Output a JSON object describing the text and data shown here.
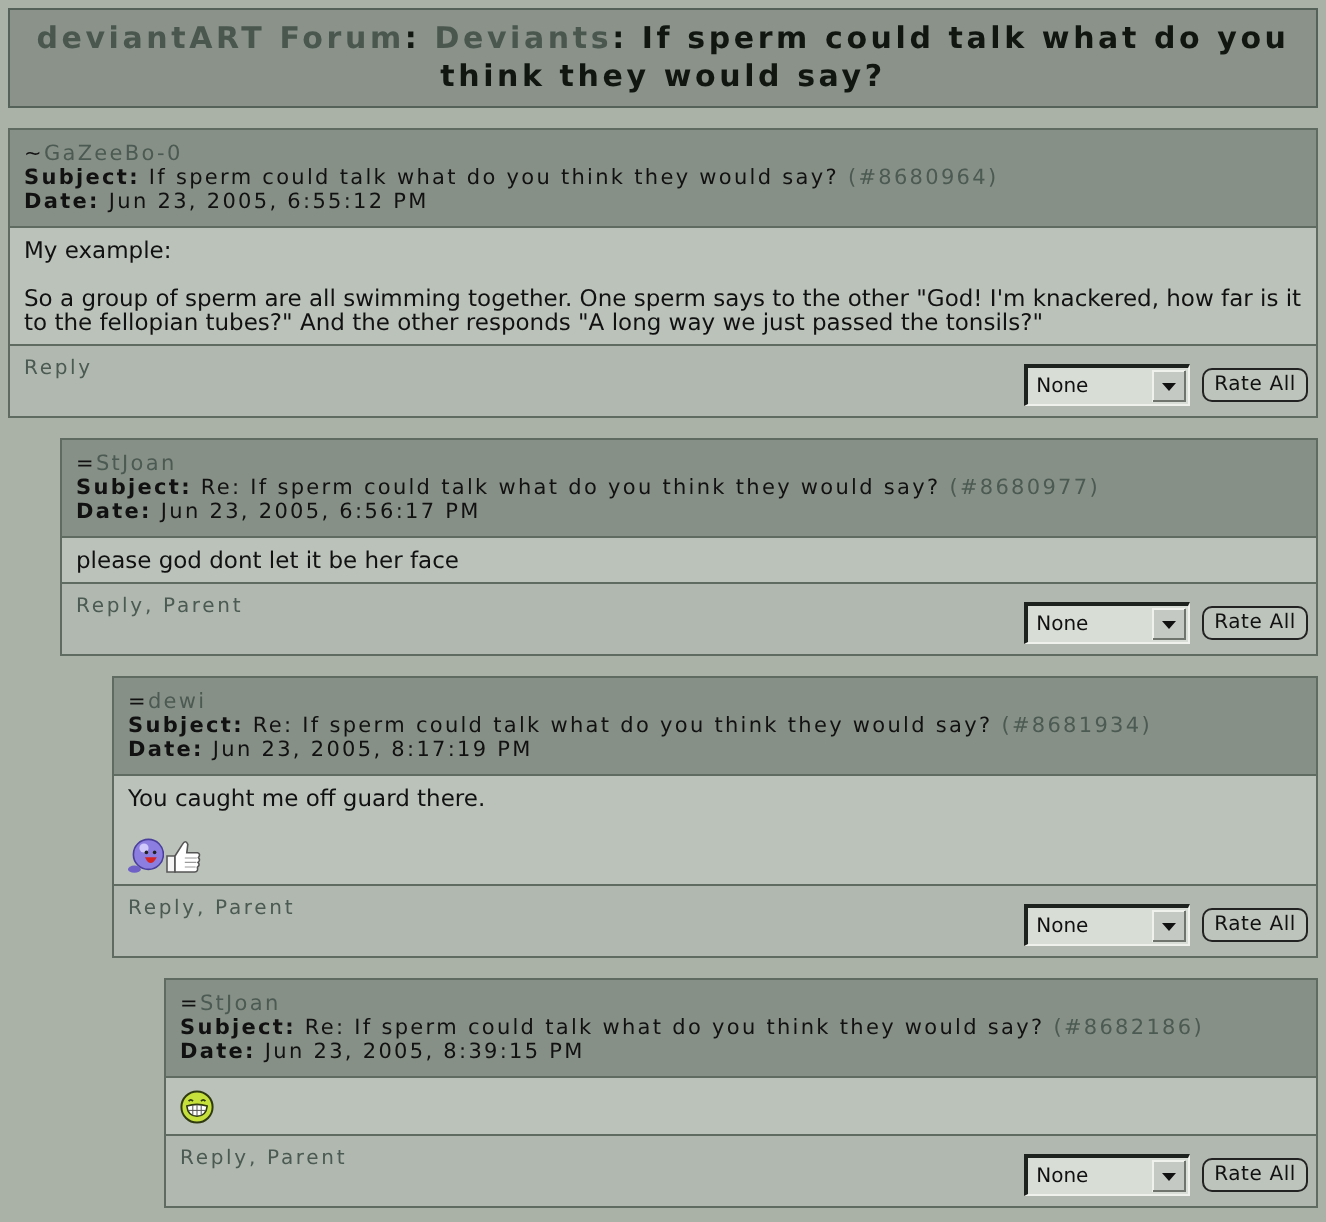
{
  "title": {
    "parts": [
      {
        "kind": "link",
        "text": "deviantART Forum"
      },
      {
        "kind": "plain",
        "text": ": "
      },
      {
        "kind": "link",
        "text": "Deviants"
      },
      {
        "kind": "plain",
        "text": ": If sperm could talk what do you think they would say?"
      }
    ]
  },
  "posts": [
    {
      "author_mark": "~",
      "author": "GaZeeBo-0",
      "subject_label": "Subject:",
      "subject": "If sperm could talk what do you think they would say?",
      "post_number": "(#8680964)",
      "date_label": "Date:",
      "date": "Jun 23, 2005, 6:55:12 PM",
      "body": [
        {
          "kind": "text",
          "text": "My example:"
        },
        {
          "kind": "text",
          "text": "So a group of sperm are all swimming together. One sperm says to the other \"God! I'm knackered, how far is it to the fellopian tubes?\" And the other responds \"A long way we just passed the tonsils?\""
        }
      ],
      "footer": {
        "links": [
          "Reply"
        ],
        "rating": "None",
        "button": "Rate All"
      },
      "children": [
        {
          "author_mark": "=",
          "author": "StJoan",
          "subject_label": "Subject:",
          "subject": "Re: If sperm could talk what do you think they would say?",
          "post_number": "(#8680977)",
          "date_label": "Date:",
          "date": "Jun 23, 2005, 6:56:17 PM",
          "body": [
            {
              "kind": "text",
              "text": "please god dont let it be her face"
            }
          ],
          "footer": {
            "links": [
              "Reply",
              "Parent"
            ],
            "separator": ",",
            "rating": "None",
            "button": "Rate All"
          },
          "children": [
            {
              "author_mark": "=",
              "author": "dewi",
              "subject_label": "Subject:",
              "subject": "Re: If sperm could talk what do you think they would say?",
              "post_number": "(#8681934)",
              "date_label": "Date:",
              "date": "Jun 23, 2005, 8:17:19 PM",
              "body": [
                {
                  "kind": "text",
                  "text": "You caught me off guard there."
                },
                {
                  "kind": "emoticons",
                  "items": [
                    {
                      "kind": "blob"
                    },
                    {
                      "kind": "thumb"
                    }
                  ]
                }
              ],
              "footer": {
                "links": [
                  "Reply",
                  "Parent"
                ],
                "separator": ",",
                "rating": "None",
                "button": "Rate All"
              },
              "children": [
                {
                  "author_mark": "=",
                  "author": "StJoan",
                  "subject_label": "Subject:",
                  "subject": "Re: If sperm could talk what do you think they would say?",
                  "post_number": "(#8682186)",
                  "date_label": "Date:",
                  "date": "Jun 23, 2005, 8:39:15 PM",
                  "body": [
                    {
                      "kind": "emoticons",
                      "items": [
                        {
                          "kind": "grin"
                        }
                      ]
                    }
                  ],
                  "footer": {
                    "links": [
                      "Reply",
                      "Parent"
                    ],
                    "separator": ",",
                    "rating": "None",
                    "button": "Rate All"
                  }
                }
              ]
            }
          ]
        }
      ]
    }
  ]
}
